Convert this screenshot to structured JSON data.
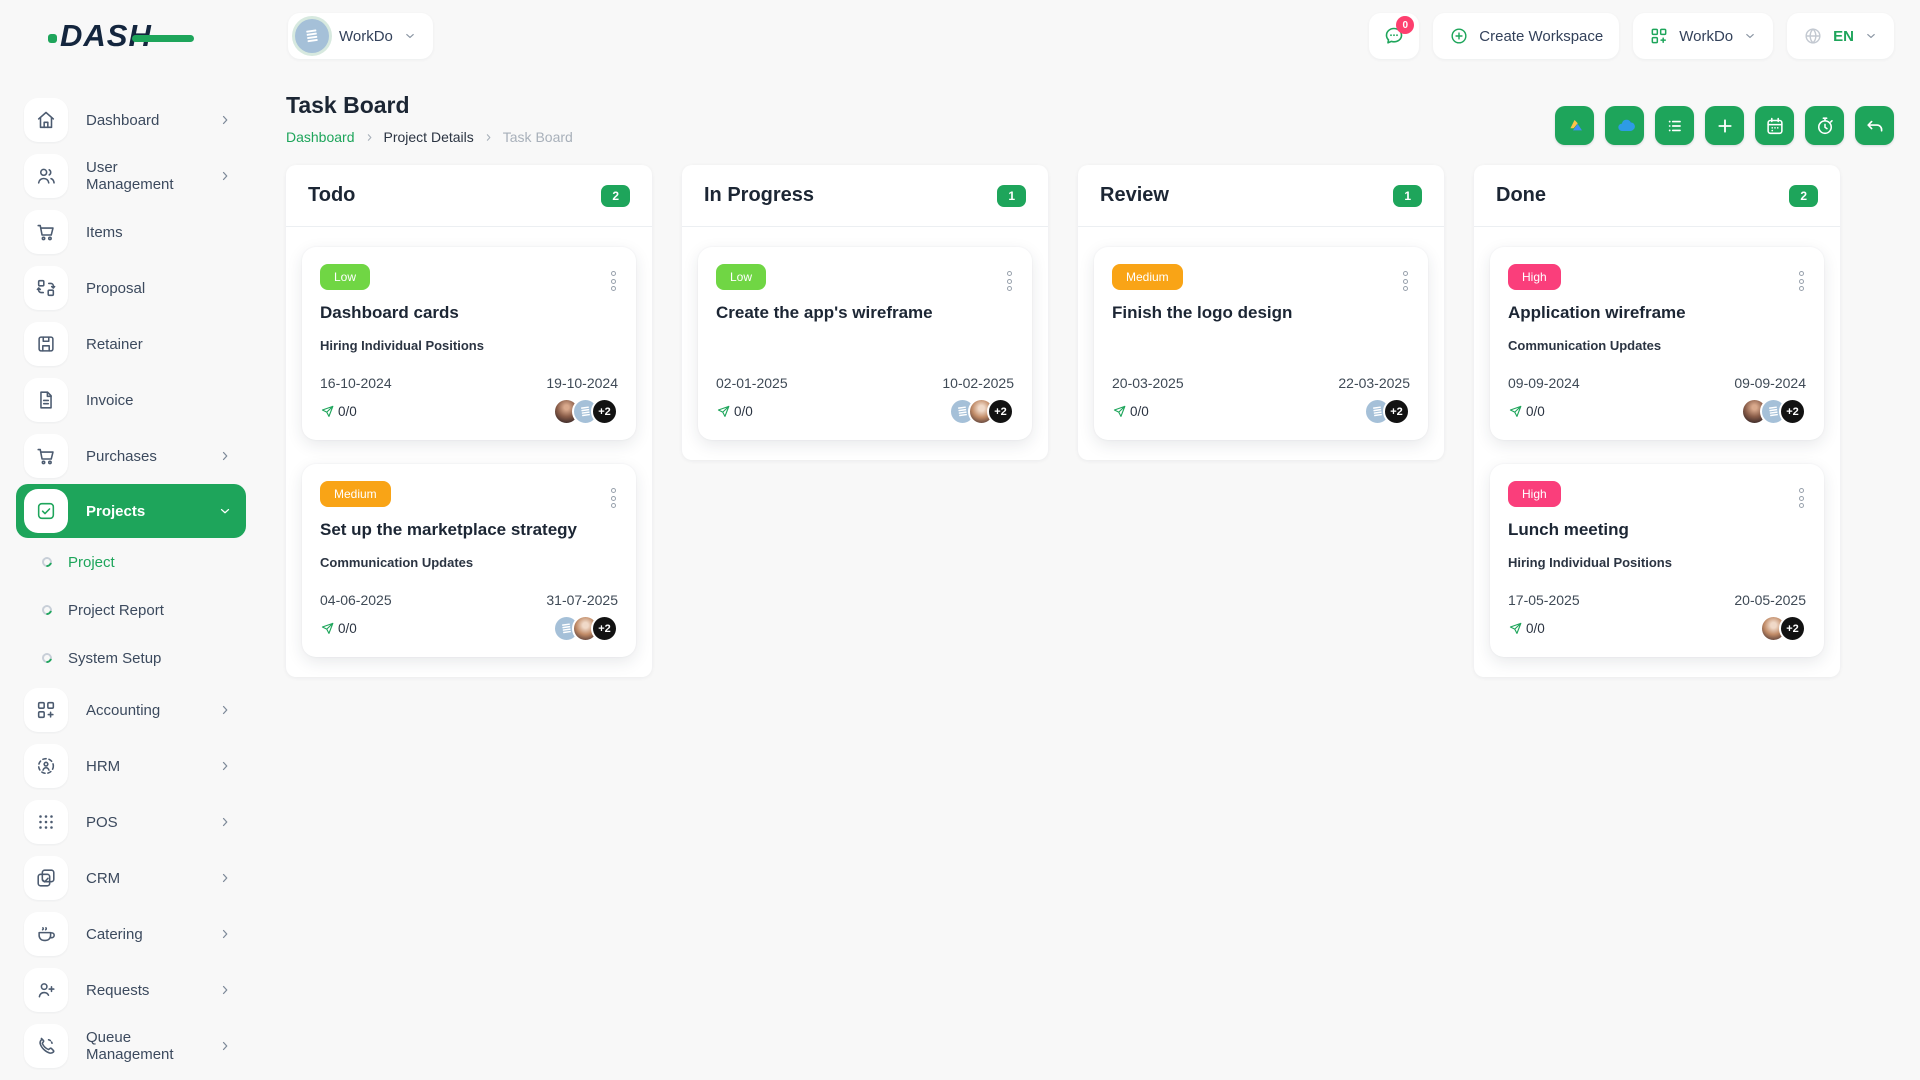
{
  "header": {
    "logo_text": "DASH",
    "workspace_switcher": {
      "label": "WorkDo"
    },
    "chat_badge": "0",
    "create_workspace_label": "Create Workspace",
    "app_menu_label": "WorkDo",
    "language_label": "EN"
  },
  "page": {
    "title": "Task Board",
    "breadcrumb": {
      "items": [
        "Dashboard",
        "Project Details",
        "Task Board"
      ]
    }
  },
  "toolbar": {
    "buttons": [
      "google-drive",
      "onedrive",
      "list",
      "plus",
      "calendar",
      "timer",
      "undo"
    ]
  },
  "sidebar": {
    "items": [
      {
        "label": "Dashboard",
        "icon": "home",
        "chevron": true
      },
      {
        "label": "User Management",
        "icon": "users",
        "chevron": true
      },
      {
        "label": "Items",
        "icon": "cart",
        "chevron": false
      },
      {
        "label": "Proposal",
        "icon": "proposal",
        "chevron": false
      },
      {
        "label": "Retainer",
        "icon": "save",
        "chevron": false
      },
      {
        "label": "Invoice",
        "icon": "invoice",
        "chevron": false
      },
      {
        "label": "Purchases",
        "icon": "cart",
        "chevron": true
      },
      {
        "label": "Projects",
        "icon": "check-square",
        "chevron": true,
        "active": true,
        "expanded": true
      },
      {
        "label": "Project",
        "type": "sub",
        "active": true
      },
      {
        "label": "Project Report",
        "type": "sub"
      },
      {
        "label": "System Setup",
        "type": "sub"
      },
      {
        "label": "Accounting",
        "icon": "grid-plus",
        "chevron": true
      },
      {
        "label": "HRM",
        "icon": "hrm",
        "chevron": true
      },
      {
        "label": "POS",
        "icon": "dots-grid",
        "chevron": true
      },
      {
        "label": "CRM",
        "icon": "crm",
        "chevron": true
      },
      {
        "label": "Catering",
        "icon": "coffee",
        "chevron": true
      },
      {
        "label": "Requests",
        "icon": "user-plus",
        "chevron": true
      },
      {
        "label": "Queue Management",
        "icon": "phone",
        "chevron": true
      }
    ]
  },
  "board": {
    "columns": [
      {
        "title": "Todo",
        "count": "2",
        "cards": [
          {
            "priority": "Low",
            "title": "Dashboard cards",
            "milestone": "Hiring Individual Positions",
            "start_date": "16-10-2024",
            "end_date": "19-10-2024",
            "progress": "0/0",
            "avatars": [
              {
                "type": "photo1"
              },
              {
                "type": "logo"
              },
              {
                "type": "more",
                "label": "+2"
              }
            ]
          },
          {
            "priority": "Medium",
            "title": "Set up the marketplace strategy",
            "milestone": "Communication Updates",
            "start_date": "04-06-2025",
            "end_date": "31-07-2025",
            "progress": "0/0",
            "avatars": [
              {
                "type": "logo"
              },
              {
                "type": "photo2"
              },
              {
                "type": "more",
                "label": "+2"
              }
            ]
          }
        ]
      },
      {
        "title": "In Progress",
        "count": "1",
        "cards": [
          {
            "priority": "Low",
            "title": "Create the app's wireframe",
            "milestone": "",
            "start_date": "02-01-2025",
            "end_date": "10-02-2025",
            "progress": "0/0",
            "avatars": [
              {
                "type": "logo"
              },
              {
                "type": "photo2"
              },
              {
                "type": "more",
                "label": "+2"
              }
            ]
          }
        ]
      },
      {
        "title": "Review",
        "count": "1",
        "cards": [
          {
            "priority": "Medium",
            "title": "Finish the logo design",
            "milestone": "",
            "start_date": "20-03-2025",
            "end_date": "22-03-2025",
            "progress": "0/0",
            "avatars": [
              {
                "type": "logo"
              },
              {
                "type": "more",
                "label": "+2"
              }
            ]
          }
        ]
      },
      {
        "title": "Done",
        "count": "2",
        "cards": [
          {
            "priority": "High",
            "title": "Application wireframe",
            "milestone": "Communication Updates",
            "start_date": "09-09-2024",
            "end_date": "09-09-2024",
            "progress": "0/0",
            "avatars": [
              {
                "type": "photo1"
              },
              {
                "type": "logo"
              },
              {
                "type": "more",
                "label": "+2"
              }
            ]
          },
          {
            "priority": "High",
            "title": "Lunch meeting",
            "milestone": "Hiring Individual Positions",
            "start_date": "17-05-2025",
            "end_date": "20-05-2025",
            "progress": "0/0",
            "avatars": [
              {
                "type": "photo2"
              },
              {
                "type": "more",
                "label": "+2"
              }
            ]
          }
        ]
      }
    ]
  },
  "colors": {
    "accent_green": "#1EA55B",
    "low": "#70D644",
    "medium": "#F9A416",
    "high": "#FA3E7B",
    "badge_pink": "#FD3F6E"
  }
}
